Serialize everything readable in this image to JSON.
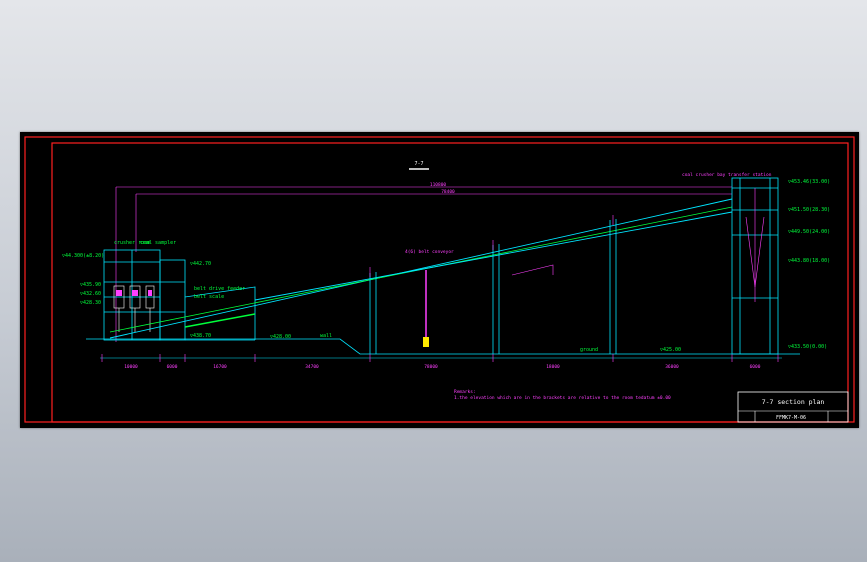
{
  "drawing": {
    "section_tag": "7-7",
    "title_block": {
      "title": "7-7 section plan",
      "drawing_no": "FFMK7-M-06"
    },
    "remarks": {
      "heading": "Remarks:",
      "line": "1.the elevation which are in the brackets are relative to the room tedatum ±0.00"
    },
    "labels": {
      "top_label": "coal crusher bay transfer station",
      "belt_conveyor": "4(6) belt conveyor",
      "belt_in_house": "coal belt",
      "upper_label": "crusher room",
      "sample_label": "coal sampler",
      "feeder_label": "belt drive feeder",
      "feeder_label2": "belt scale",
      "wall_label": "wall",
      "ground_label": "ground"
    },
    "elevations_left": [
      "▽44.300(±8.20)",
      "▽435.90",
      "▽432.60",
      "▽428.30"
    ],
    "elevations_mid": [
      "▽442.70",
      "▽438.70",
      "▽428.00",
      "▽425.00"
    ],
    "elevations_right": [
      "▽453.46(33.00)",
      "▽451.50(28.30)",
      "▽449.50(24.00)",
      "▽443.80(18.00)",
      "▽433.50(0.00)"
    ],
    "dimensions": {
      "top": [
        "110800",
        "78400"
      ],
      "bottom": [
        "10000",
        "6000",
        "16700",
        "34700",
        "78000",
        "18000",
        "36000",
        "6000"
      ]
    },
    "colors": {
      "background": "#000000",
      "border": "#ff2020",
      "structure": "#00e5ff",
      "annotation": "#ff40ff",
      "text": "#00ff3c"
    }
  }
}
